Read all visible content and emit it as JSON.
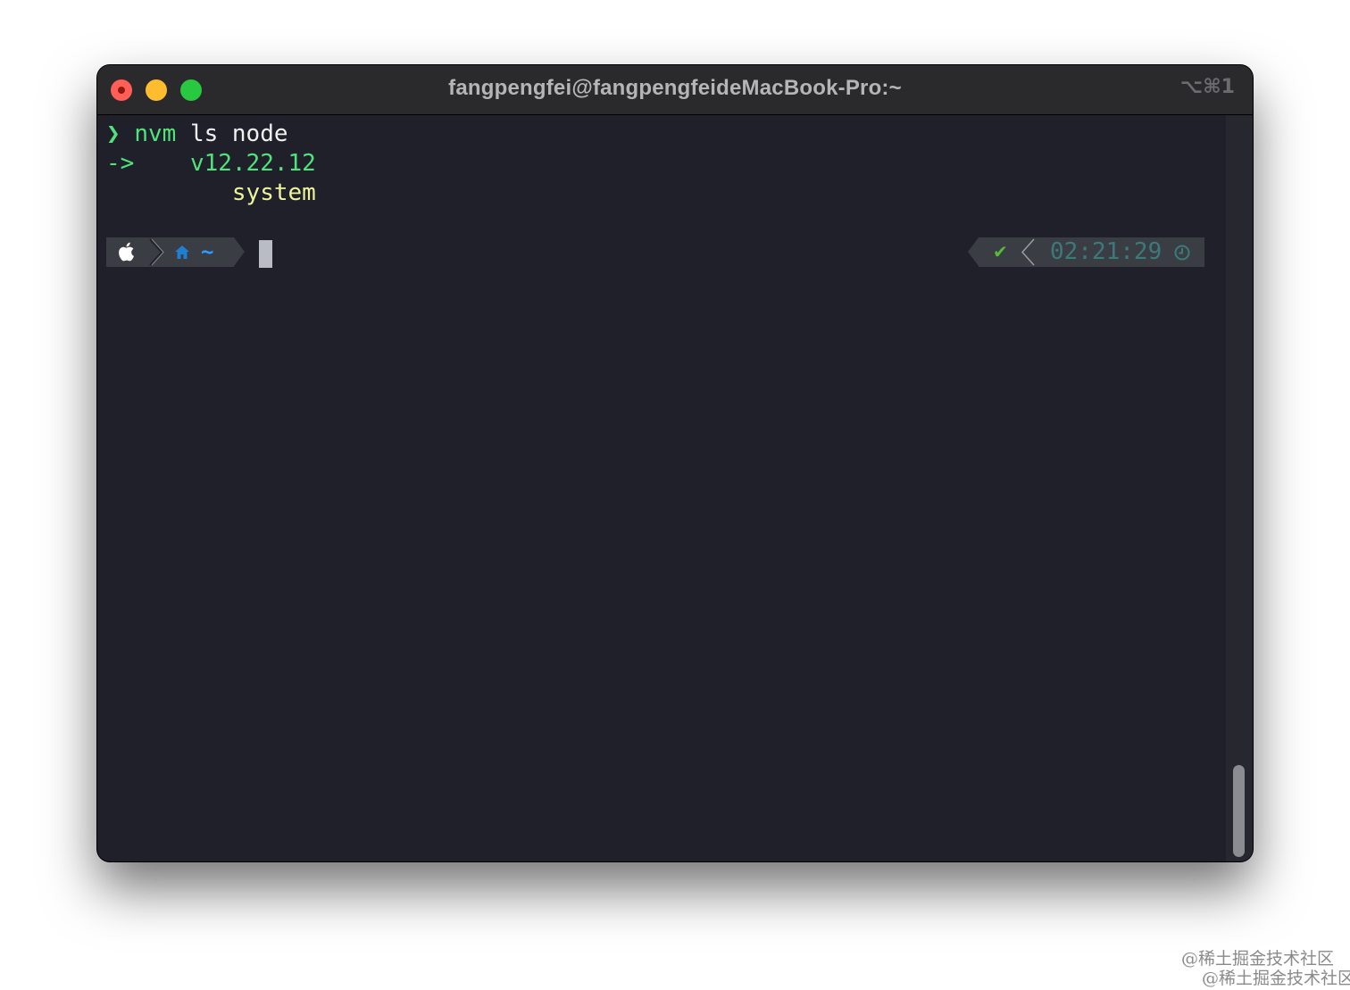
{
  "window": {
    "title": "fangpengfei@fangpengfeideMacBook-Pro:~",
    "shortcut": "⌥⌘1",
    "controls": [
      "close",
      "minimize",
      "maximize"
    ]
  },
  "terminal": {
    "lines": [
      {
        "prompt_symbol": "❯",
        "command": "nvm",
        "args": "ls node"
      },
      {
        "arrow": "->",
        "version": "v12.22.12"
      },
      {
        "text": "system"
      }
    ],
    "prompt": {
      "os_icon": "apple-icon",
      "dir_icon": "home-icon",
      "dir": "~",
      "status_icon": "✔",
      "time": "02:21:29",
      "time_icon": "clock-icon"
    },
    "colors": {
      "background": "#1f2029",
      "green": "#50e37b",
      "yellow": "#eef39a",
      "segment": "#3b3d44",
      "dir": "#2e9bff",
      "time": "#3c7a7a"
    }
  },
  "watermarks": [
    "@稀土掘金技术社区",
    "@稀土掘金技术社区"
  ]
}
